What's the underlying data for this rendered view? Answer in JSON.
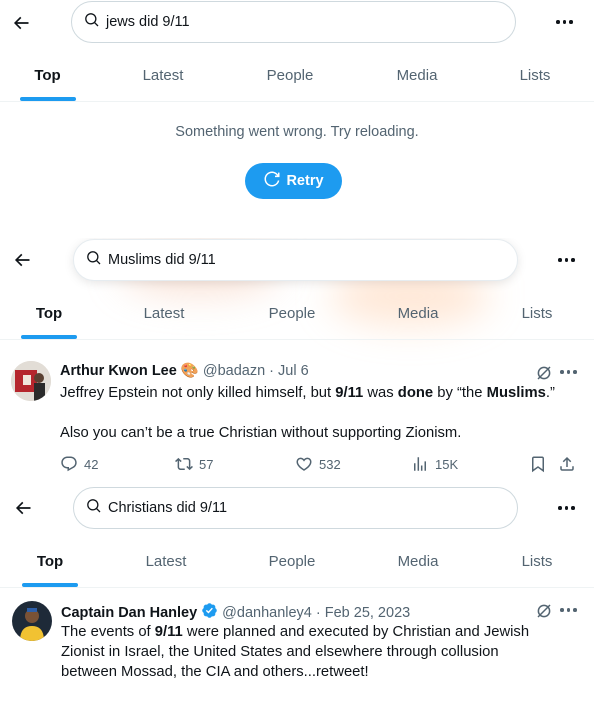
{
  "panels": [
    {
      "search_query": "jews did 9/11",
      "tabs": [
        "Top",
        "Latest",
        "People",
        "Media",
        "Lists"
      ],
      "active_tab": "Top",
      "error": {
        "message": "Something went wrong. Try reloading.",
        "retry_label": "Retry"
      }
    },
    {
      "search_query": "Muslims did 9/11",
      "tabs": [
        "Top",
        "Latest",
        "People",
        "Media",
        "Lists"
      ],
      "active_tab": "Top",
      "post": {
        "author": "Arthur Kwon Lee",
        "author_emoji": "🎨",
        "handle": "@badazn",
        "date": "Jul 6",
        "line1": {
          "t1": "Jeffrey Epstein not only killed himself, but ",
          "b1": "9/11",
          "t2": " was ",
          "b2": "done",
          "t3": " by “the ",
          "b3": "Muslims",
          "t4": ".”"
        },
        "line2": "Also you can’t be a true Christian without supporting Zionism.",
        "replies": "42",
        "reposts": "57",
        "likes": "532",
        "views": "15K"
      }
    },
    {
      "search_query": "Christians did 9/11",
      "tabs": [
        "Top",
        "Latest",
        "People",
        "Media",
        "Lists"
      ],
      "active_tab": "Top",
      "post": {
        "author": "Captain Dan Hanley",
        "handle": "@danhanley4",
        "date": "Feb 25, 2023",
        "line1": {
          "t1": "The events of ",
          "b1": "9/11",
          "t2": " were planned and executed by Christian and Jewish"
        },
        "line2": "Zionist in Israel, the United States and elsewhere through collusion",
        "line3": "between Mossad, the CIA and others...retweet!"
      }
    }
  ],
  "colors": {
    "accent": "#1d9bf0",
    "text": "#0f1419",
    "secondary_text": "#536471",
    "border": "#cfd9de"
  },
  "icons": [
    "back-arrow-icon",
    "search-icon",
    "more-icon",
    "refresh-icon",
    "grok-icon",
    "reply-icon",
    "repost-icon",
    "like-icon",
    "views-icon",
    "bookmark-icon",
    "share-icon",
    "verified-badge-icon"
  ]
}
